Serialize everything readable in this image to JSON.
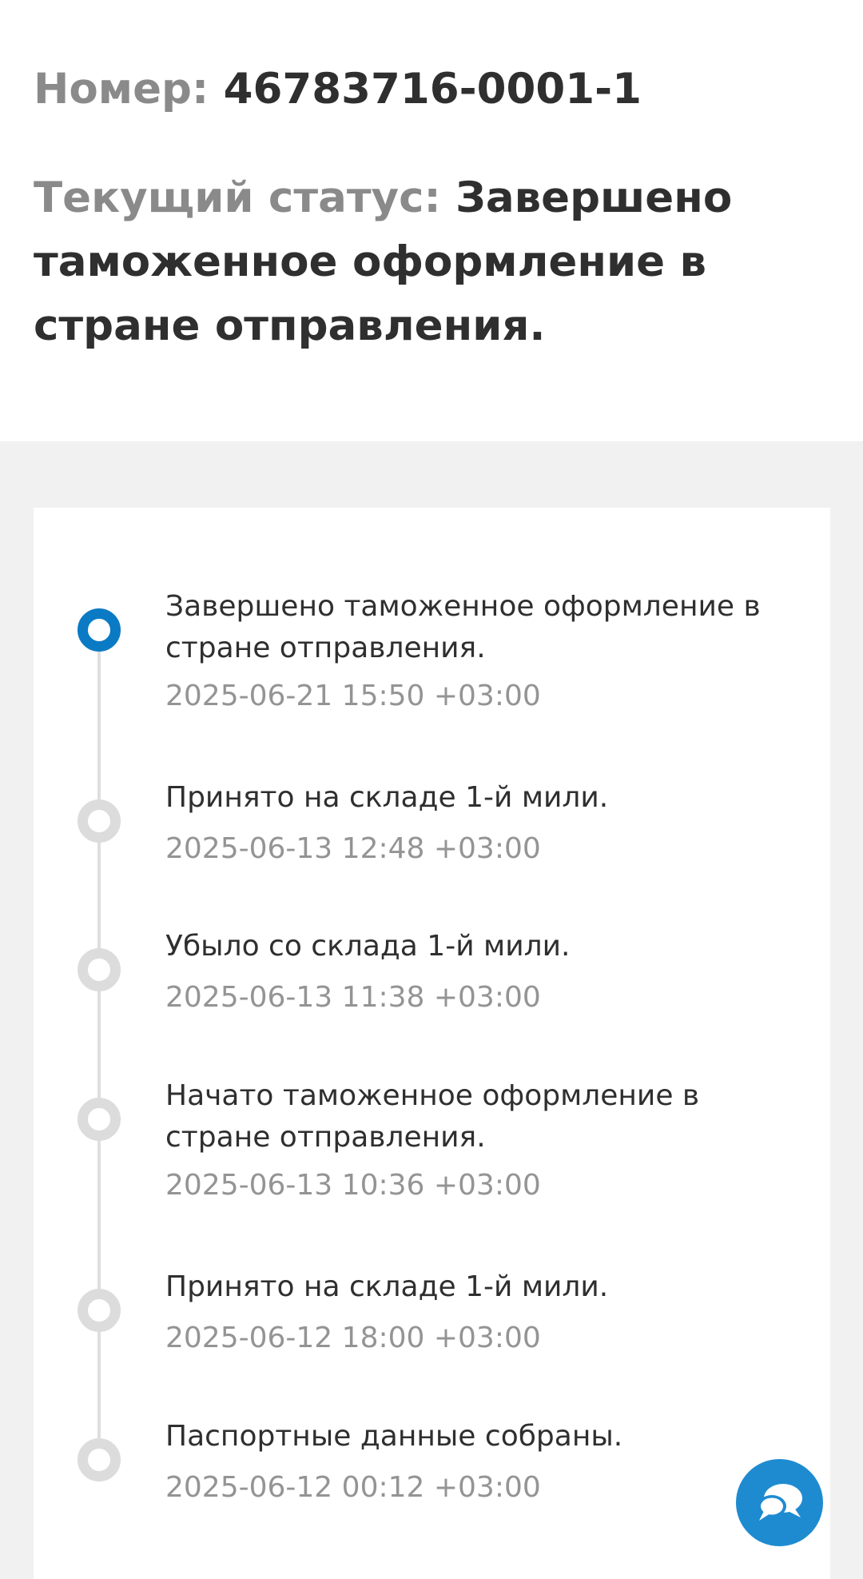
{
  "header": {
    "number_label": "Номер:",
    "number_value": "46783716-0001-1",
    "status_label": "Текущий статус:",
    "status_value": "Завершено таможенное оформление в стране отправления."
  },
  "timeline": {
    "events": [
      {
        "title": "Завершено таможенное оформление в стране отправления.",
        "time": "2025-06-21 15:50 +03:00",
        "active": true
      },
      {
        "title": "Принято на складе 1-й мили.",
        "time": "2025-06-13 12:48 +03:00",
        "active": false
      },
      {
        "title": "Убыло со склада 1-й мили.",
        "time": "2025-06-13 11:38 +03:00",
        "active": false
      },
      {
        "title": "Начато таможенное оформление в стране отправления.",
        "time": "2025-06-13 10:36 +03:00",
        "active": false
      },
      {
        "title": "Принято на складе 1-й мили.",
        "time": "2025-06-12 18:00 +03:00",
        "active": false
      },
      {
        "title": "Паспортные данные собраны.",
        "time": "2025-06-12 00:12 +03:00",
        "active": false
      }
    ]
  },
  "chat": {
    "icon": "chat-bubbles-icon"
  },
  "colors": {
    "accent": "#0b7ac4",
    "chat_button": "#1e8bd1",
    "muted_text": "#8a8a8a",
    "inactive_dot": "#dcdcdc",
    "page_background": "#f1f1f1"
  }
}
